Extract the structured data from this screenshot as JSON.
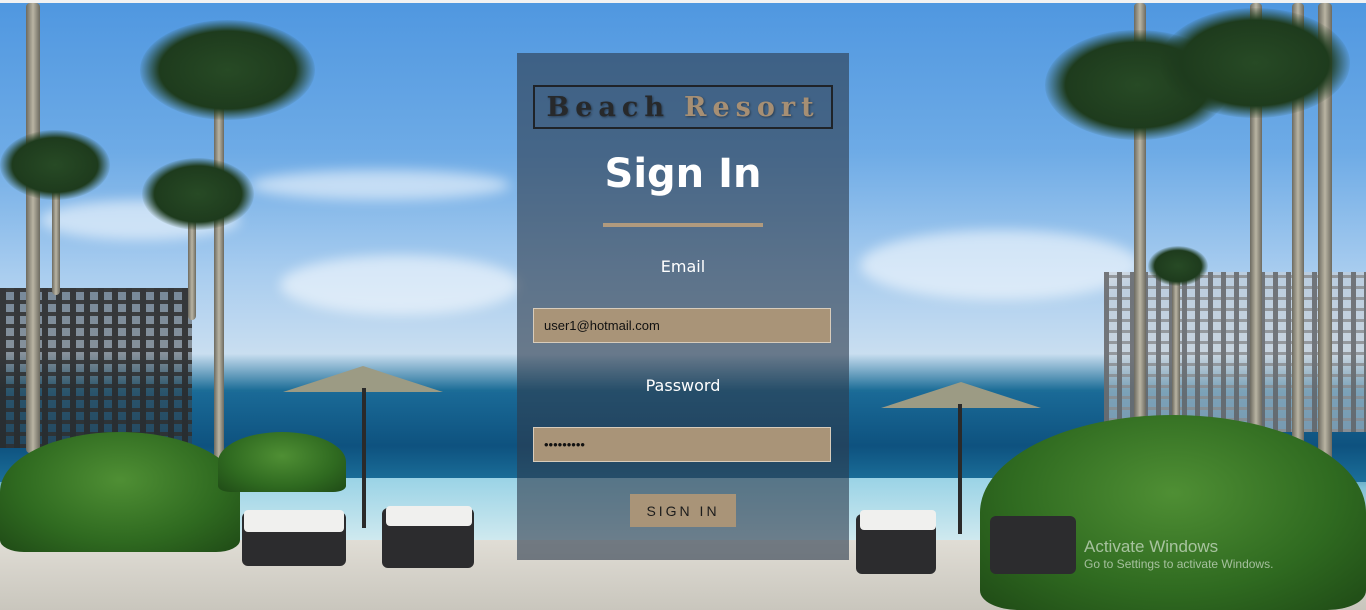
{
  "logo": {
    "word1": "Beach",
    "word2": "Resort"
  },
  "form": {
    "title": "Sign In",
    "email_label": "Email",
    "email_value": "user1@hotmail.com",
    "password_label": "Password",
    "password_value": "user12345",
    "submit_label": "SIGN IN"
  },
  "watermark": {
    "title": "Activate Windows",
    "subtitle": "Go to Settings to activate Windows."
  },
  "colors": {
    "accent": "#a99478",
    "panel": "#2d3c4e"
  }
}
